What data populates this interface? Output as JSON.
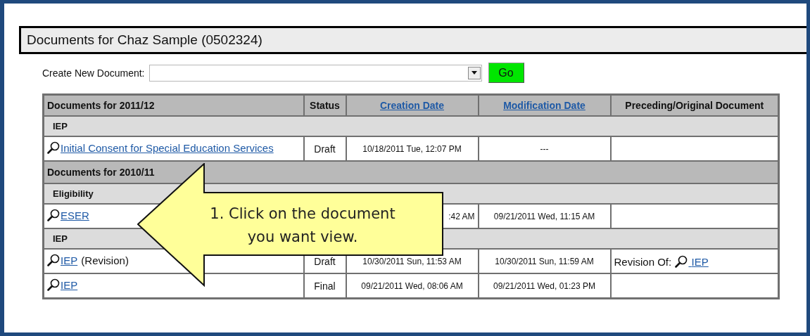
{
  "page_title": "Documents for Chaz Sample (0502324)",
  "create": {
    "label": "Create New Document:",
    "button": "Go"
  },
  "table": {
    "columns": [
      {
        "label": "Documents for 2011/12",
        "sortable": false
      },
      {
        "label": "Status",
        "sortable": false
      },
      {
        "label": "Creation Date",
        "sortable": true
      },
      {
        "label": "Modification Date",
        "sortable": true
      },
      {
        "label": "Preceding/Original Document",
        "sortable": false
      }
    ],
    "rows": [
      {
        "kind": "category",
        "label": "IEP"
      },
      {
        "kind": "document",
        "title": "Initial Consent for Special Education Services",
        "status": "Draft",
        "created": "10/18/2011 Tue, 12:07 PM",
        "modified": "---"
      },
      {
        "kind": "year",
        "label": "Documents for 2010/11"
      },
      {
        "kind": "category",
        "label": "Eligibility"
      },
      {
        "kind": "document",
        "title": "ESER",
        "created": ":42 AM",
        "modified": "09/21/2011 Wed, 11:15 AM"
      },
      {
        "kind": "category",
        "label": "IEP"
      },
      {
        "kind": "document",
        "title": "IEP",
        "note": "(Revision)",
        "status": "Draft",
        "created": "10/30/2011 Sun, 11:53 AM",
        "modified": "10/30/2011 Sun, 11:59 AM",
        "preceding": {
          "label": "Revision Of:",
          "link": "IEP"
        }
      },
      {
        "kind": "document",
        "title": "IEP",
        "status": "Final",
        "created": "09/21/2011 Wed, 08:06 AM",
        "modified": "09/21/2011 Wed, 01:23 PM"
      }
    ]
  },
  "callout": {
    "text": "1. Click on the document you want view."
  }
}
